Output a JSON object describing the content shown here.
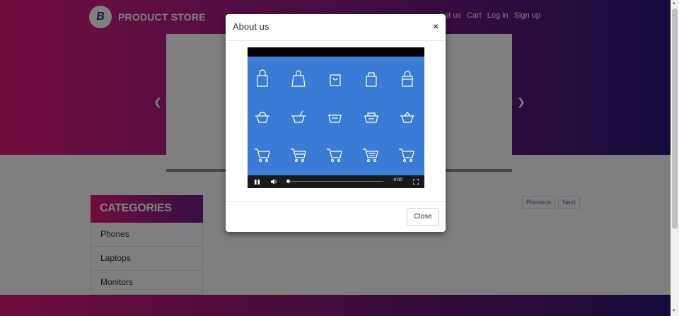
{
  "brand": {
    "logo_letter": "B",
    "name": "PRODUCT STORE"
  },
  "nav": {
    "links": [
      "About us",
      "Cart",
      "Log in",
      "Sign up"
    ],
    "about_visible": "out us"
  },
  "carousel": {
    "prev_icon": "chevron-left-icon",
    "next_icon": "chevron-right-icon"
  },
  "categories": {
    "title": "CATEGORIES",
    "items": [
      "Phones",
      "Laptops",
      "Monitors"
    ]
  },
  "pager": {
    "previous": "Previous",
    "next": "Next"
  },
  "modal": {
    "title": "About us",
    "close_x": "×",
    "close_button": "Close",
    "video": {
      "time": "-0:00",
      "icons": [
        "shopping-bag-icon",
        "shopping-basket-icon",
        "shopping-cart-icon"
      ]
    }
  },
  "colors": {
    "accent": "#e11b7a",
    "dark": "#2a1678",
    "video_bg": "#3a7bd5",
    "link": "#337ab7"
  }
}
